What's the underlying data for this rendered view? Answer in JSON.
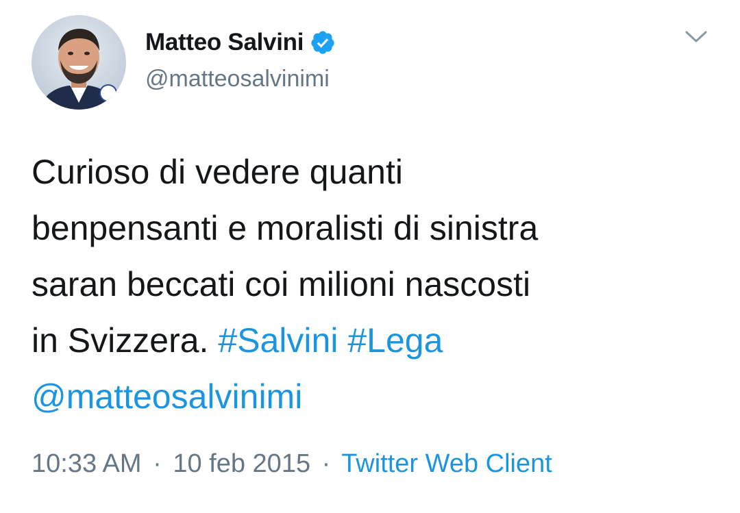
{
  "author": {
    "display_name": "Matteo Salvini",
    "handle": "@matteosalvinimi",
    "verified": true,
    "avatar_icon": "profile-photo-avatar"
  },
  "tweet": {
    "lines": [
      "Curioso di vedere quanti",
      "benpensanti e moralisti di sinistra",
      "saran beccati coi milioni nascosti",
      "in Svizzera. "
    ],
    "hashtags": [
      "#Salvini",
      "#Lega"
    ],
    "mention": "@matteosalvinimi"
  },
  "meta": {
    "time": "10:33 AM",
    "separator": "·",
    "date": "10 feb 2015",
    "source": "Twitter Web Client"
  },
  "icons": {
    "verified": "verified-badge-icon",
    "more": "chevron-down-icon"
  },
  "colors": {
    "link": "#1b95e0",
    "secondary_text": "#657786",
    "primary_text": "#14171a",
    "verified_badge": "#1da1f2"
  }
}
